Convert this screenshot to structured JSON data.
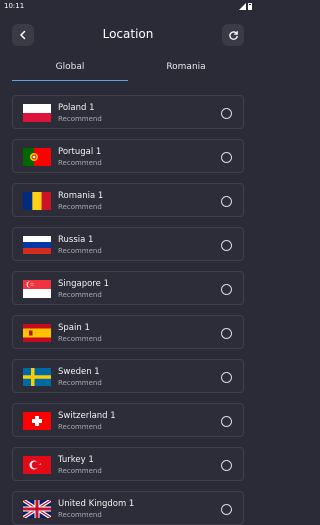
{
  "status": {
    "time": "10:11"
  },
  "header": {
    "title": "Location"
  },
  "tabs": [
    {
      "label": "Global"
    },
    {
      "label": "Romania"
    }
  ],
  "locations": [
    {
      "name": "Poland 1",
      "sub": "Recommend",
      "flag": "poland"
    },
    {
      "name": "Portugal 1",
      "sub": "Recommend",
      "flag": "portugal"
    },
    {
      "name": "Romania 1",
      "sub": "Recommend",
      "flag": "romania"
    },
    {
      "name": "Russia 1",
      "sub": "Recommend",
      "flag": "russia"
    },
    {
      "name": "Singapore 1",
      "sub": "Recommend",
      "flag": "singapore"
    },
    {
      "name": "Spain 1",
      "sub": "Recommend",
      "flag": "spain"
    },
    {
      "name": "Sweden 1",
      "sub": "Recommend",
      "flag": "sweden"
    },
    {
      "name": "Switzerland 1",
      "sub": "Recommend",
      "flag": "switzerland"
    },
    {
      "name": "Turkey 1",
      "sub": "Recommend",
      "flag": "turkey"
    },
    {
      "name": "United Kingdom 1",
      "sub": "Recommend",
      "flag": "united-kingdom"
    }
  ],
  "colors": {
    "background": "#2a2b36",
    "tab_underline": "#5aa5e8"
  }
}
